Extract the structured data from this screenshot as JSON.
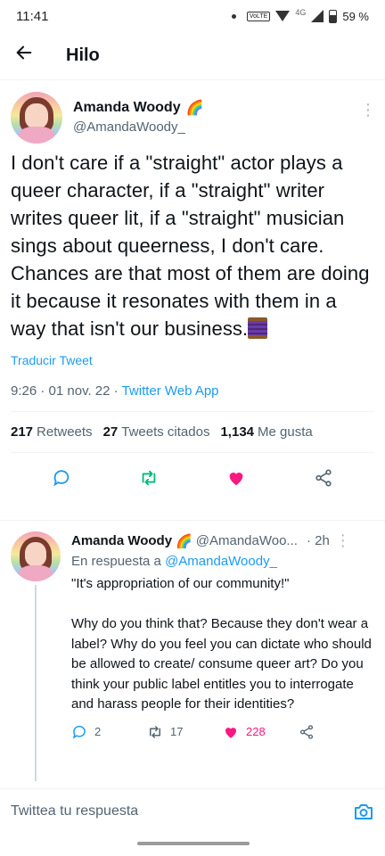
{
  "status_bar": {
    "time": "11:41",
    "network": "4G",
    "volte": "VoLTE",
    "battery": "59 %"
  },
  "app_bar": {
    "back_icon": "arrow-left-icon",
    "title": "Hilo"
  },
  "main_tweet": {
    "author_name": "Amanda Woody",
    "author_emoji": "🌈",
    "author_handle": "@AmandaWoody_",
    "text": "I don't care if a \"straight\" actor plays a queer character, if a \"straight\" writer writes queer lit, if a \"straight\" musician sings about queerness, I don't care. Chances are that most of them are doing it because it resonates with them in a way that isn't our business.",
    "translate_label": "Traducir Tweet",
    "time": "9:26",
    "date": "01 nov. 22",
    "source": "Twitter Web App",
    "stats": {
      "retweets_count": "217",
      "retweets_label": "Retweets",
      "quotes_count": "27",
      "quotes_label": "Tweets citados",
      "likes_count": "1,134",
      "likes_label": "Me gusta"
    }
  },
  "reply_tweet": {
    "author_name": "Amanda Woody",
    "author_emoji": "🌈",
    "author_handle": "@AmandaWoo...",
    "time_ago": "2h",
    "reply_prefix": "En respuesta a",
    "reply_mention": "@AmandaWoody_",
    "text": "\"It's appropriation of our community!\"\n\nWhy do you think that? Because they don't wear a label? Why do you feel you can dictate who should be allowed to create/ consume queer art? Do you think your public label entitles you to interrogate and harass people for their identities?",
    "reply_count": "2",
    "retweet_count": "17",
    "like_count": "228"
  },
  "compose": {
    "placeholder": "Twittea tu respuesta"
  },
  "colors": {
    "accent": "#1d9bf0",
    "retweet": "#00ba7c",
    "like": "#f91880",
    "muted": "#536471"
  }
}
